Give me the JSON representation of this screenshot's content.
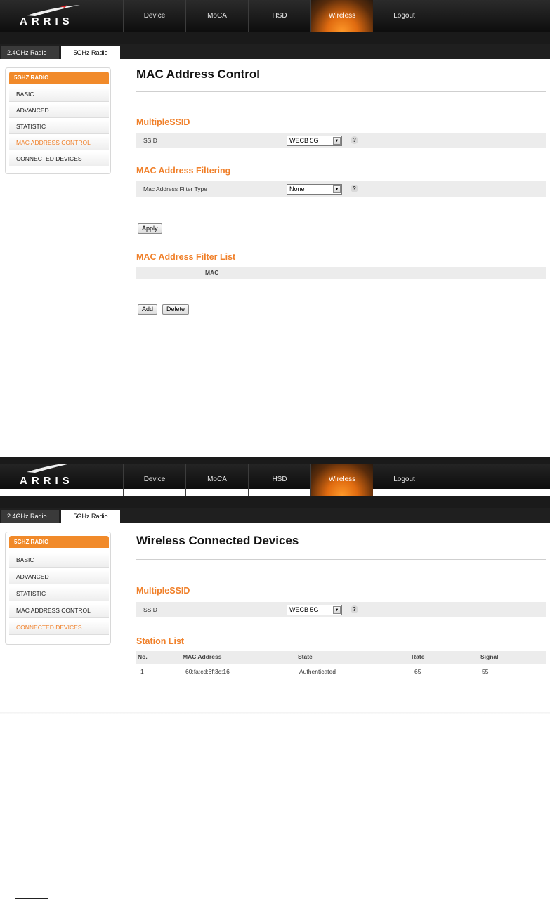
{
  "brand": {
    "logo_text": "ARRIS"
  },
  "nav": [
    "Device",
    "MoCA",
    "HSD",
    "Wireless",
    "Logout"
  ],
  "subtabs": [
    "2.4GHz Radio",
    "5GHz Radio"
  ],
  "sidebar": {
    "header": "5GHZ RADIO",
    "items": [
      "BASIC",
      "ADVANCED",
      "STATISTIC",
      "MAC ADDRESS CONTROL",
      "CONNECTED DEVICES"
    ]
  },
  "shot1": {
    "title": "MAC Address Control",
    "multiple_ssid_title": "MultipleSSID",
    "ssid_label": "SSID",
    "ssid_value": "WECB 5G",
    "filtering_title": "MAC Address Filtering",
    "filter_type_label": "Mac Address Filter Type",
    "filter_type_value": "None",
    "apply_label": "Apply",
    "filter_list_title": "MAC Address Filter List",
    "mac_column": "MAC",
    "add_label": "Add",
    "delete_label": "Delete"
  },
  "shot2": {
    "title": "Wireless Connected Devices",
    "multiple_ssid_title": "MultipleSSID",
    "ssid_label": "SSID",
    "ssid_value": "WECB 5G",
    "station_list_title": "Station List",
    "columns": [
      "No.",
      "MAC Address",
      "State",
      "Rate",
      "Signal"
    ],
    "rows": [
      {
        "no": "1",
        "mac": "60:fa:cd:6f:3c:16",
        "state": "Authenticated",
        "rate": "65",
        "signal": "55"
      }
    ]
  },
  "help_glyph": "?",
  "arrow_glyph": "▼",
  "icons": [
    "help-icon",
    "dropdown-arrow-icon",
    "arris-logo-swoosh"
  ]
}
